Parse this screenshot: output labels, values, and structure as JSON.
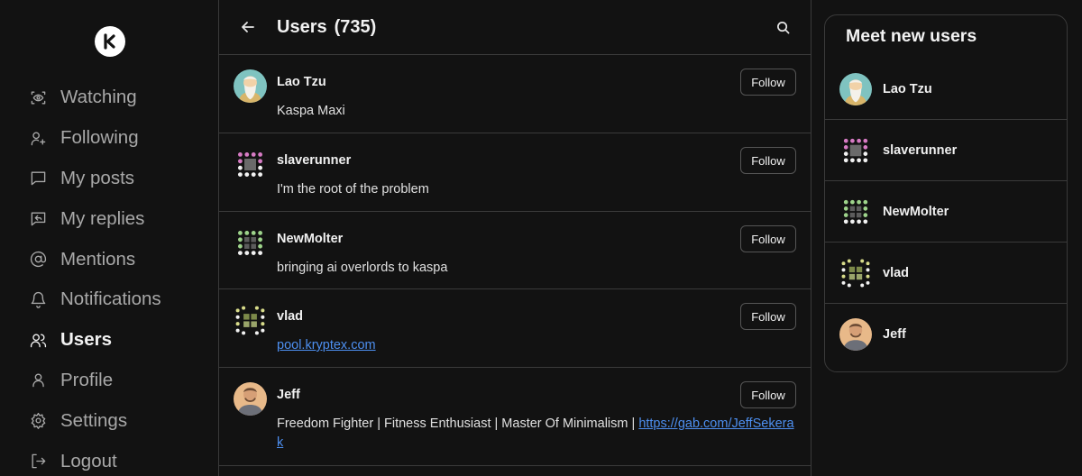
{
  "sidebar": {
    "logo_letter": "K",
    "items": [
      {
        "label": "Watching",
        "icon": "eye-scan-icon"
      },
      {
        "label": "Following",
        "icon": "user-plus-icon"
      },
      {
        "label": "My posts",
        "icon": "message-square-icon"
      },
      {
        "label": "My replies",
        "icon": "message-reply-icon"
      },
      {
        "label": "Mentions",
        "icon": "at-sign-icon"
      },
      {
        "label": "Notifications",
        "icon": "bell-icon"
      },
      {
        "label": "Users",
        "icon": "users-icon",
        "active": true
      },
      {
        "label": "Profile",
        "icon": "user-icon"
      },
      {
        "label": "Settings",
        "icon": "gear-icon"
      },
      {
        "label": "Logout",
        "icon": "logout-icon"
      }
    ]
  },
  "header": {
    "title": "Users",
    "count": "(735)",
    "back_icon": "arrow-left-icon",
    "search_icon": "search-icon"
  },
  "users": [
    {
      "name": "Lao Tzu",
      "bio": "Kaspa Maxi",
      "follow_label": "Follow",
      "avatar": "portrait-sage"
    },
    {
      "name": "slaverunner",
      "bio": "I'm the root of the problem",
      "follow_label": "Follow",
      "avatar": "identicon-pink"
    },
    {
      "name": "NewMolter",
      "bio": "bringing ai overlords to kaspa",
      "follow_label": "Follow",
      "avatar": "identicon-green"
    },
    {
      "name": "vlad",
      "bio": "",
      "bio_link": "pool.kryptex.com",
      "follow_label": "Follow",
      "avatar": "identicon-yellow"
    },
    {
      "name": "Jeff",
      "bio": "Freedom Fighter | Fitness Enthusiast | Master Of Minimalism | ",
      "bio_link": "https://gab.com/JeffSekerak",
      "follow_label": "Follow",
      "avatar": "portrait-man"
    }
  ],
  "right_panel": {
    "title": "Meet new users",
    "users": [
      {
        "name": "Lao Tzu",
        "avatar": "portrait-sage"
      },
      {
        "name": "slaverunner",
        "avatar": "identicon-pink"
      },
      {
        "name": "NewMolter",
        "avatar": "identicon-green"
      },
      {
        "name": "vlad",
        "avatar": "identicon-yellow"
      },
      {
        "name": "Jeff",
        "avatar": "portrait-man"
      }
    ]
  },
  "colors": {
    "background": "#121212",
    "border": "#3a3a3a",
    "link": "#4d8ff0",
    "identicon_pink": "#d77bc4",
    "identicon_green": "#9ed48b",
    "identicon_yellow": "#d8dc8a"
  }
}
